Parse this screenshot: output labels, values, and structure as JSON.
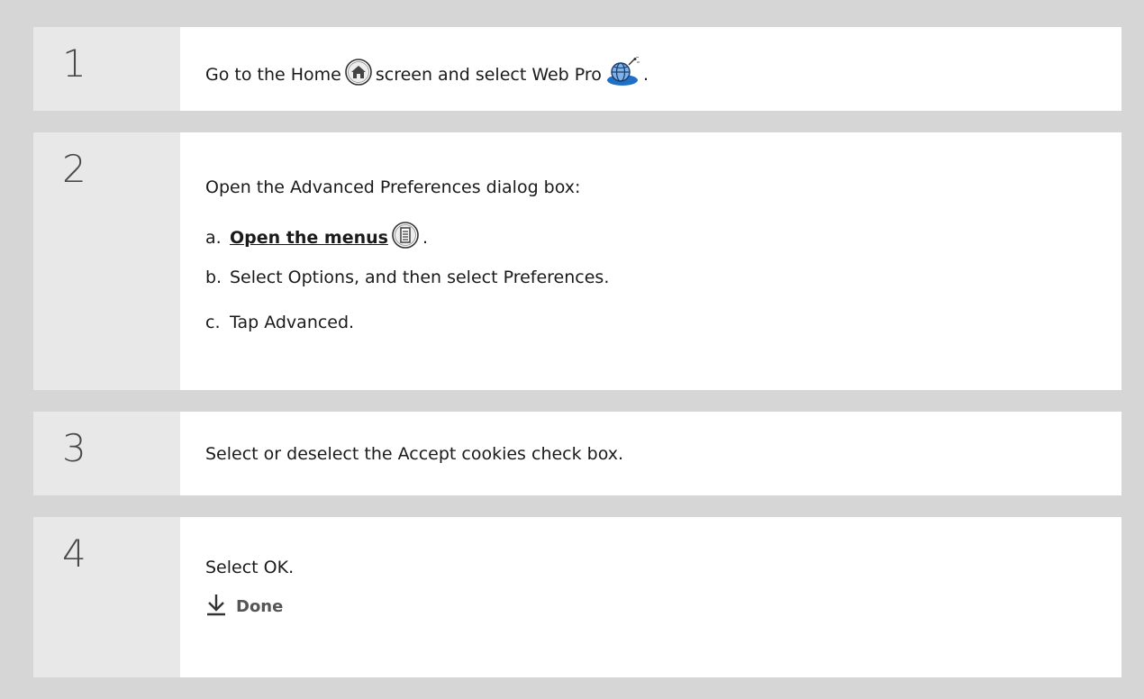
{
  "steps": [
    {
      "number": "1",
      "text_before_home": "Go to the Home",
      "text_after_home": "screen and select Web Pro",
      "text_end": ".",
      "icons": [
        "home-icon",
        "web-pro-globe-icon"
      ]
    },
    {
      "number": "2",
      "intro": "Open the Advanced Preferences dialog box:",
      "items": [
        {
          "letter": "a.",
          "link": "Open the menus",
          "icon": "menu-icon",
          "suffix": "."
        },
        {
          "letter": "b.",
          "text": "Select Options, and then select Preferences."
        },
        {
          "letter": "c.",
          "text": "Tap Advanced."
        }
      ]
    },
    {
      "number": "3",
      "text": "Select or deselect the Accept cookies check box."
    },
    {
      "number": "4",
      "text": "Select OK.",
      "done_label": "Done",
      "done_icon": "down-arrow-icon"
    }
  ],
  "colors": {
    "background": "#d6d6d6",
    "number_cell": "#e8e8e8",
    "content_cell": "#ffffff",
    "globe_blue": "#1f6fc7"
  }
}
